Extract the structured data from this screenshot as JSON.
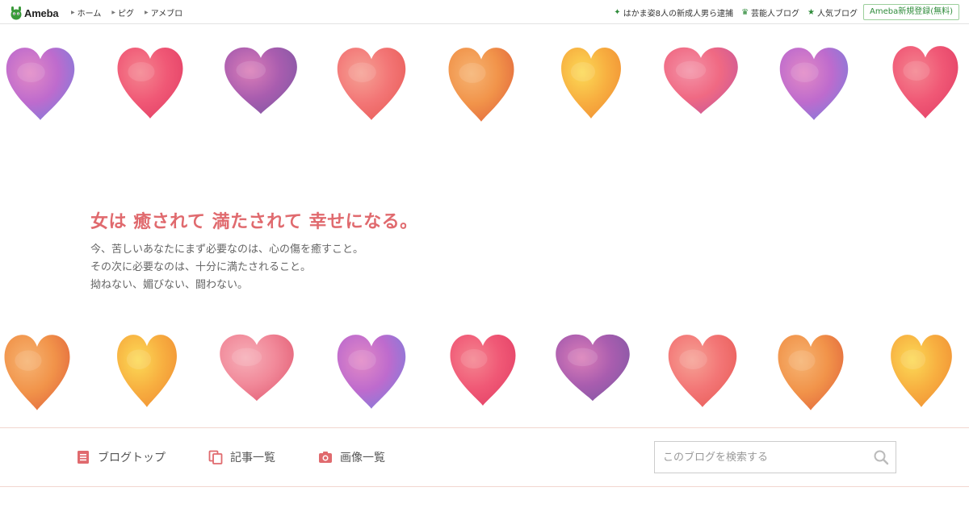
{
  "topbar": {
    "logo_text": "Ameba",
    "nav": [
      {
        "label": "ホーム"
      },
      {
        "label": "ピグ"
      },
      {
        "label": "アメブロ"
      }
    ],
    "links": [
      {
        "label": "はかま姿8人の新成人男ら逮捕",
        "icon": "sparkle-icon"
      },
      {
        "label": "芸能人ブログ",
        "icon": "crown-icon"
      },
      {
        "label": "人気ブログ",
        "icon": "star-icon"
      }
    ],
    "register_label": "Ameba新規登録(無料)"
  },
  "header": {
    "catchphrase": "女は 癒されて 満たされて 幸せになる。",
    "lead_lines": [
      "今、苦しいあなたにまず必要なのは、心の傷を癒すこと。",
      "その次に必要なのは、十分に満たされること。",
      "拗ねない、媚びない、闘わない。"
    ]
  },
  "blog_nav": {
    "items": [
      {
        "label": "ブログトップ",
        "icon": "document-icon"
      },
      {
        "label": "記事一覧",
        "icon": "copy-icon"
      },
      {
        "label": "画像一覧",
        "icon": "camera-icon"
      }
    ],
    "search_placeholder": "このブログを検索する"
  },
  "colors": {
    "accent": "#e06a6e",
    "green": "#2e8b3a",
    "border_pink": "#f2d6cf"
  }
}
